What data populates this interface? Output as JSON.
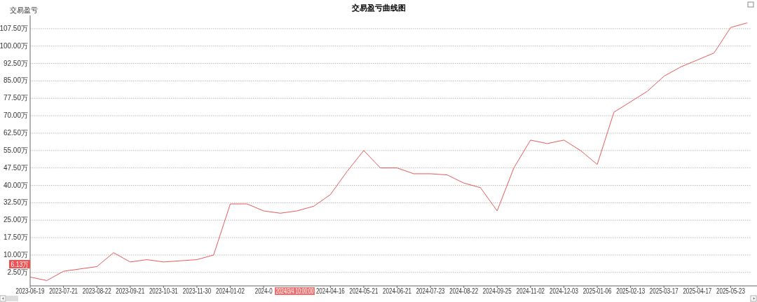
{
  "chart": {
    "crosshair": {
      "value_label": "6.13万",
      "date_label": "2024/3/4 10:00:00"
    },
    "chart_data": {
      "type": "line",
      "title": "交易盈亏曲线图",
      "ylabel": "交易盈亏",
      "categories": [
        "2023-06-19",
        null,
        "2023-07-21",
        null,
        "2023-08-22",
        null,
        "2023-09-21",
        null,
        "2023-10-31",
        null,
        "2023-11-30",
        null,
        "2024-01-02",
        null,
        "2024-0",
        null,
        null,
        null,
        "2024-04-16",
        null,
        "2024-05-21",
        null,
        "2024-06-21",
        null,
        "2024-07-23",
        null,
        "2024-08-22",
        null,
        "2024-09-25",
        null,
        "2024-11-02",
        null,
        "2024-12-03",
        null,
        "2025-01-06",
        null,
        "2025-02-13",
        null,
        "2025-03-17",
        null,
        "2025-04-17",
        null,
        "2025-05-23",
        null
      ],
      "series": [
        {
          "color": "#e03030",
          "values": [
            0.5,
            -1,
            3,
            4,
            5,
            11,
            7,
            8,
            7,
            7.5,
            8,
            10,
            32,
            32,
            29,
            28,
            29,
            31,
            36,
            46,
            55,
            47.5,
            47.5,
            45,
            45,
            44.5,
            41,
            39,
            29,
            47.5,
            59.5,
            58,
            59.5,
            55,
            49,
            71.5,
            76,
            80.5,
            87,
            91,
            94,
            97,
            108,
            110
          ]
        }
      ],
      "grid": true,
      "ylim": [
        -3.3,
        113.2
      ],
      "yticks": [
        {
          "value": 2.5,
          "label": "2.50万"
        },
        {
          "value": 10,
          "label": "10.00万"
        },
        {
          "value": 17.5,
          "label": "17.50万"
        },
        {
          "value": 25,
          "label": "25.00万"
        },
        {
          "value": 32.5,
          "label": "32.50万"
        },
        {
          "value": 40,
          "label": "40.00万"
        },
        {
          "value": 47.5,
          "label": "47.50万"
        },
        {
          "value": 55,
          "label": "55.00万"
        },
        {
          "value": 62.5,
          "label": "62.50万"
        },
        {
          "value": 70,
          "label": "70.00万"
        },
        {
          "value": 77.5,
          "label": "77.50万"
        },
        {
          "value": 85,
          "label": "85.00万"
        },
        {
          "value": 92.5,
          "label": "92.50万"
        },
        {
          "value": 100,
          "label": "100.00万"
        },
        {
          "value": 107.5,
          "label": "107.50万"
        }
      ]
    }
  }
}
